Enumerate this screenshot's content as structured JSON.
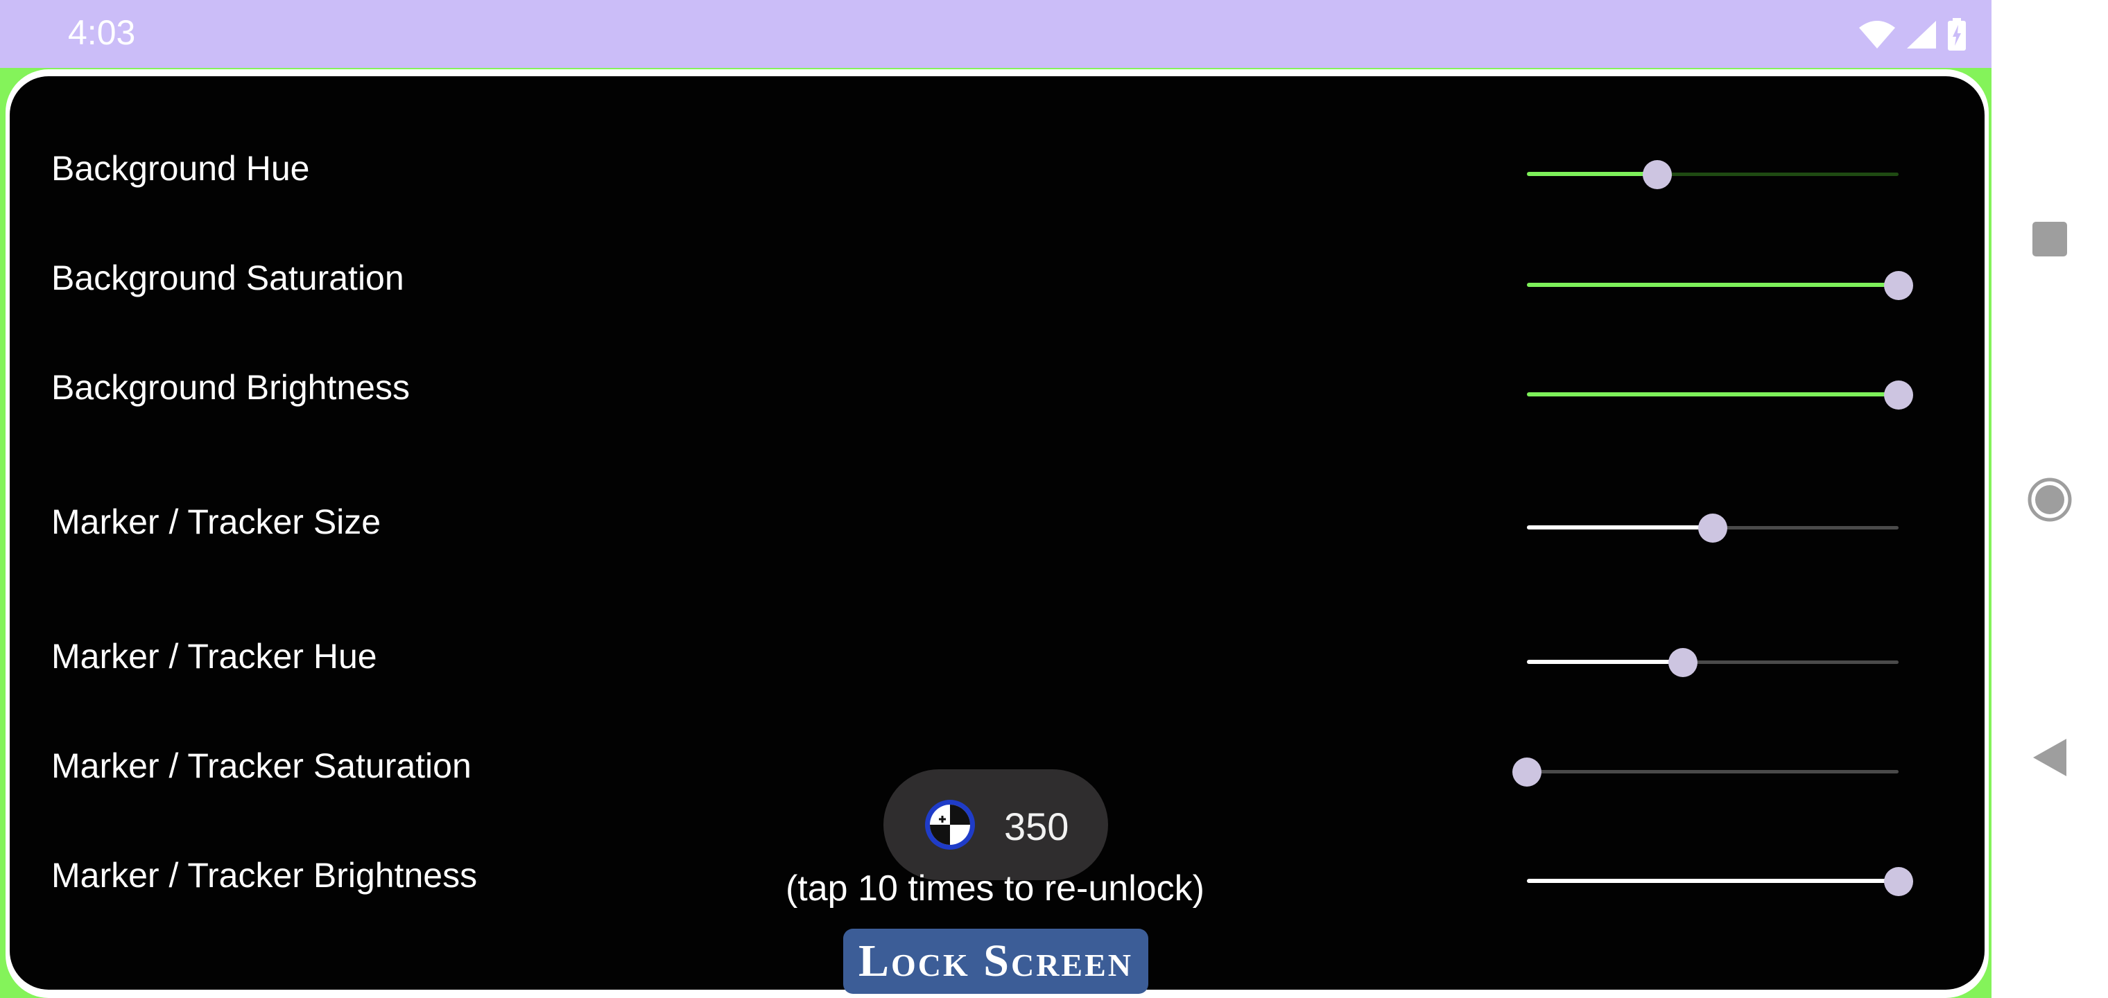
{
  "status_bar": {
    "time": "4:03",
    "icons": [
      "wifi-icon",
      "signal-icon",
      "battery-charging-icon"
    ]
  },
  "settings": {
    "rows": [
      {
        "label": "Background Hue",
        "value_fraction": 0.35,
        "style": "green"
      },
      {
        "label": "Background Saturation",
        "value_fraction": 1.0,
        "style": "green"
      },
      {
        "label": "Background Brightness",
        "value_fraction": 1.0,
        "style": "green"
      },
      {
        "label": "Marker / Tracker Size",
        "value_fraction": 0.5,
        "style": "white"
      },
      {
        "label": "Marker / Tracker Hue",
        "value_fraction": 0.42,
        "style": "white"
      },
      {
        "label": "Marker / Tracker Saturation",
        "value_fraction": 0.0,
        "style": "white"
      },
      {
        "label": "Marker / Tracker Brightness",
        "value_fraction": 1.0,
        "style": "white"
      }
    ]
  },
  "toast": {
    "icon": "app-crosshair-icon",
    "text": "350"
  },
  "hint": "(tap 10 times to re-unlock)",
  "lock_button": {
    "label": "Lock Screen"
  },
  "nav_bar": {
    "buttons": [
      "recents-square-icon",
      "home-circle-icon",
      "back-triangle-icon"
    ]
  },
  "colors": {
    "status_bar": "#cbbdf8",
    "frame_green": "#84f35a",
    "panel": "#020202",
    "slider_green": "#7df05a",
    "thumb": "#cdc5e1",
    "lock_button": "#3c5d97"
  }
}
